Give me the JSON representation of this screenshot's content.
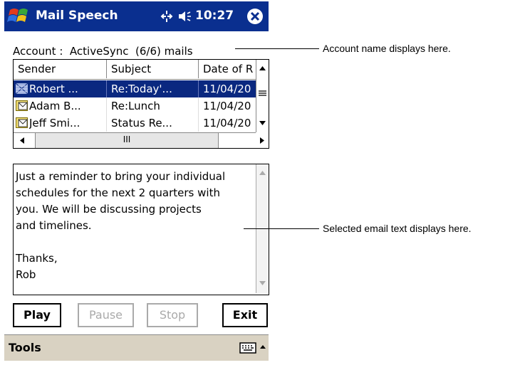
{
  "titlebar": {
    "app_title": "Mail Speech",
    "clock": "10:27",
    "color": "#0a2f8f"
  },
  "account": {
    "text": "Account :  ActiveSync  (6/6) mails"
  },
  "message_list": {
    "columns": [
      "Sender",
      "Subject",
      "Date of R"
    ],
    "rows": [
      {
        "sender": "Robert ...",
        "subject": "Re:Today'...",
        "date": "11/04/20",
        "selected": true
      },
      {
        "sender": "Adam B...",
        "subject": "Re:Lunch",
        "date": "11/04/20",
        "selected": false
      },
      {
        "sender": "Jeff Smi...",
        "subject": "Status Re...",
        "date": "11/04/20",
        "selected": false
      }
    ],
    "hscroll_thumb": "III"
  },
  "message": {
    "body": "Just a reminder to bring your individual\nschedules for the next 2 quarters with\nyou. We will be discussing projects\nand timelines.\n\nThanks,\nRob"
  },
  "buttons": {
    "play": "Play",
    "pause": "Pause",
    "stop": "Stop",
    "exit": "Exit"
  },
  "menubar": {
    "tools": "Tools"
  },
  "callouts": {
    "account": "Account name displays here.",
    "email_text": "Selected email text displays here."
  }
}
